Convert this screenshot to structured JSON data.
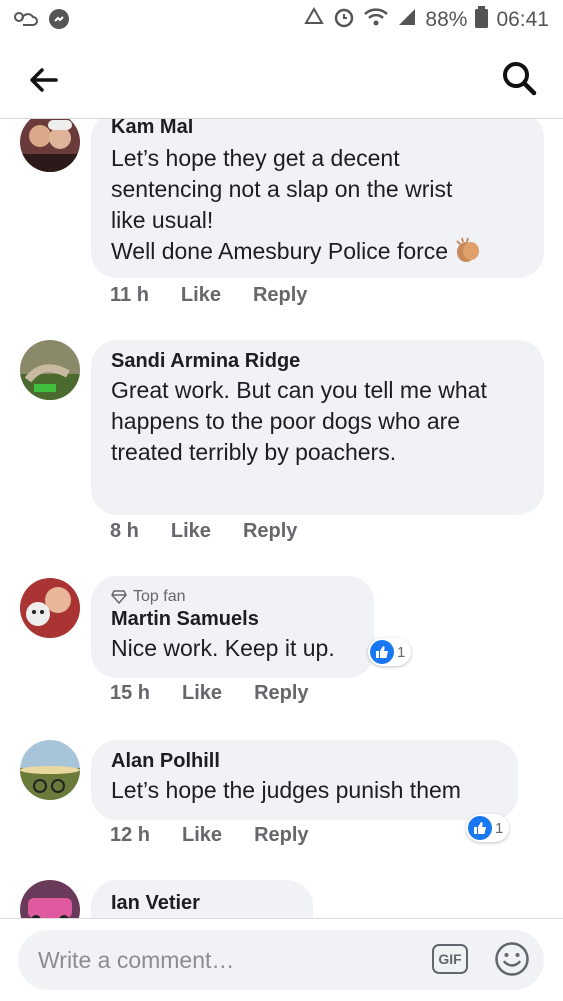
{
  "status_bar": {
    "battery": "88%",
    "time": "06:41"
  },
  "composer": {
    "placeholder": "Write a comment…",
    "gif_label": "GIF"
  },
  "comments": [
    {
      "author": "Kam Mal",
      "text": "Let’s hope they get a decent\nsentencing not a slap on the wrist\nlike usual!\nWell done Amesbury Police force",
      "time": "11 h",
      "like": "Like",
      "reply": "Reply"
    },
    {
      "author": "Sandi Armina Ridge",
      "text": "Great work. But can you tell me what\nhappens to the poor dogs who are\ntreated terribly by poachers.",
      "time": "8 h",
      "like": "Like",
      "reply": "Reply"
    },
    {
      "badge": "Top fan",
      "author": "Martin Samuels",
      "text": "Nice work. Keep it up.",
      "time": "15 h",
      "like": "Like",
      "reply": "Reply",
      "reaction_count": "1"
    },
    {
      "author": "Alan Polhill",
      "text": "Let’s hope the judges punish them",
      "time": "12 h",
      "like": "Like",
      "reply": "Reply",
      "reaction_count": "1"
    },
    {
      "author": "Ian Vetier"
    }
  ]
}
